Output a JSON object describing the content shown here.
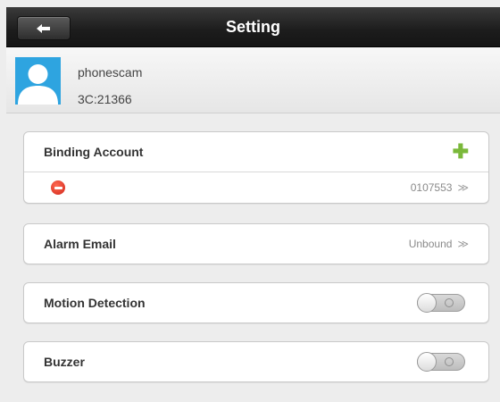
{
  "header": {
    "title": "Setting",
    "back_icon": "back-arrow-icon"
  },
  "profile": {
    "name": "phonescam",
    "device_id": "3C:21366",
    "avatar_icon": "user-avatar-icon",
    "avatar_color": "#2ea4e0"
  },
  "binding_account": {
    "label": "Binding Account",
    "add_icon": "plus-icon",
    "accounts": [
      {
        "value": "0107553",
        "chevron": "≫",
        "remove_icon": "remove-icon"
      }
    ]
  },
  "alarm_email": {
    "label": "Alarm Email",
    "value": "Unbound",
    "chevron": "≫"
  },
  "motion_detection": {
    "label": "Motion Detection",
    "enabled": false
  },
  "buzzer": {
    "label": "Buzzer",
    "enabled": false
  },
  "colors": {
    "accent_green": "#7ab83a",
    "remove_red": "#d0261a",
    "topbar": "#1c1c1c"
  }
}
